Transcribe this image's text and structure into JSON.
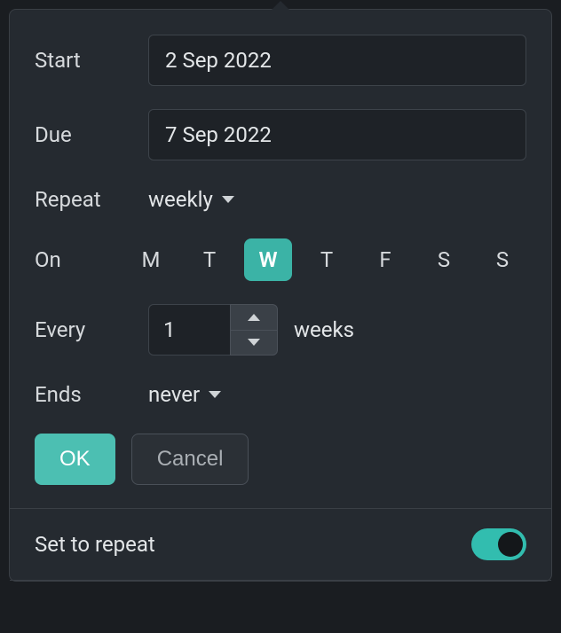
{
  "labels": {
    "start": "Start",
    "due": "Due",
    "repeat": "Repeat",
    "on": "On",
    "every": "Every",
    "ends": "Ends",
    "set_to_repeat": "Set to repeat"
  },
  "start_date": "2 Sep 2022",
  "due_date": "7 Sep 2022",
  "repeat_mode": "weekly",
  "days": [
    "M",
    "T",
    "W",
    "T",
    "F",
    "S",
    "S"
  ],
  "selected_day_index": 2,
  "every_value": "1",
  "every_unit": "weeks",
  "ends_mode": "never",
  "buttons": {
    "ok": "OK",
    "cancel": "Cancel"
  },
  "toggle_on": true,
  "colors": {
    "accent": "#3bb3a6"
  }
}
